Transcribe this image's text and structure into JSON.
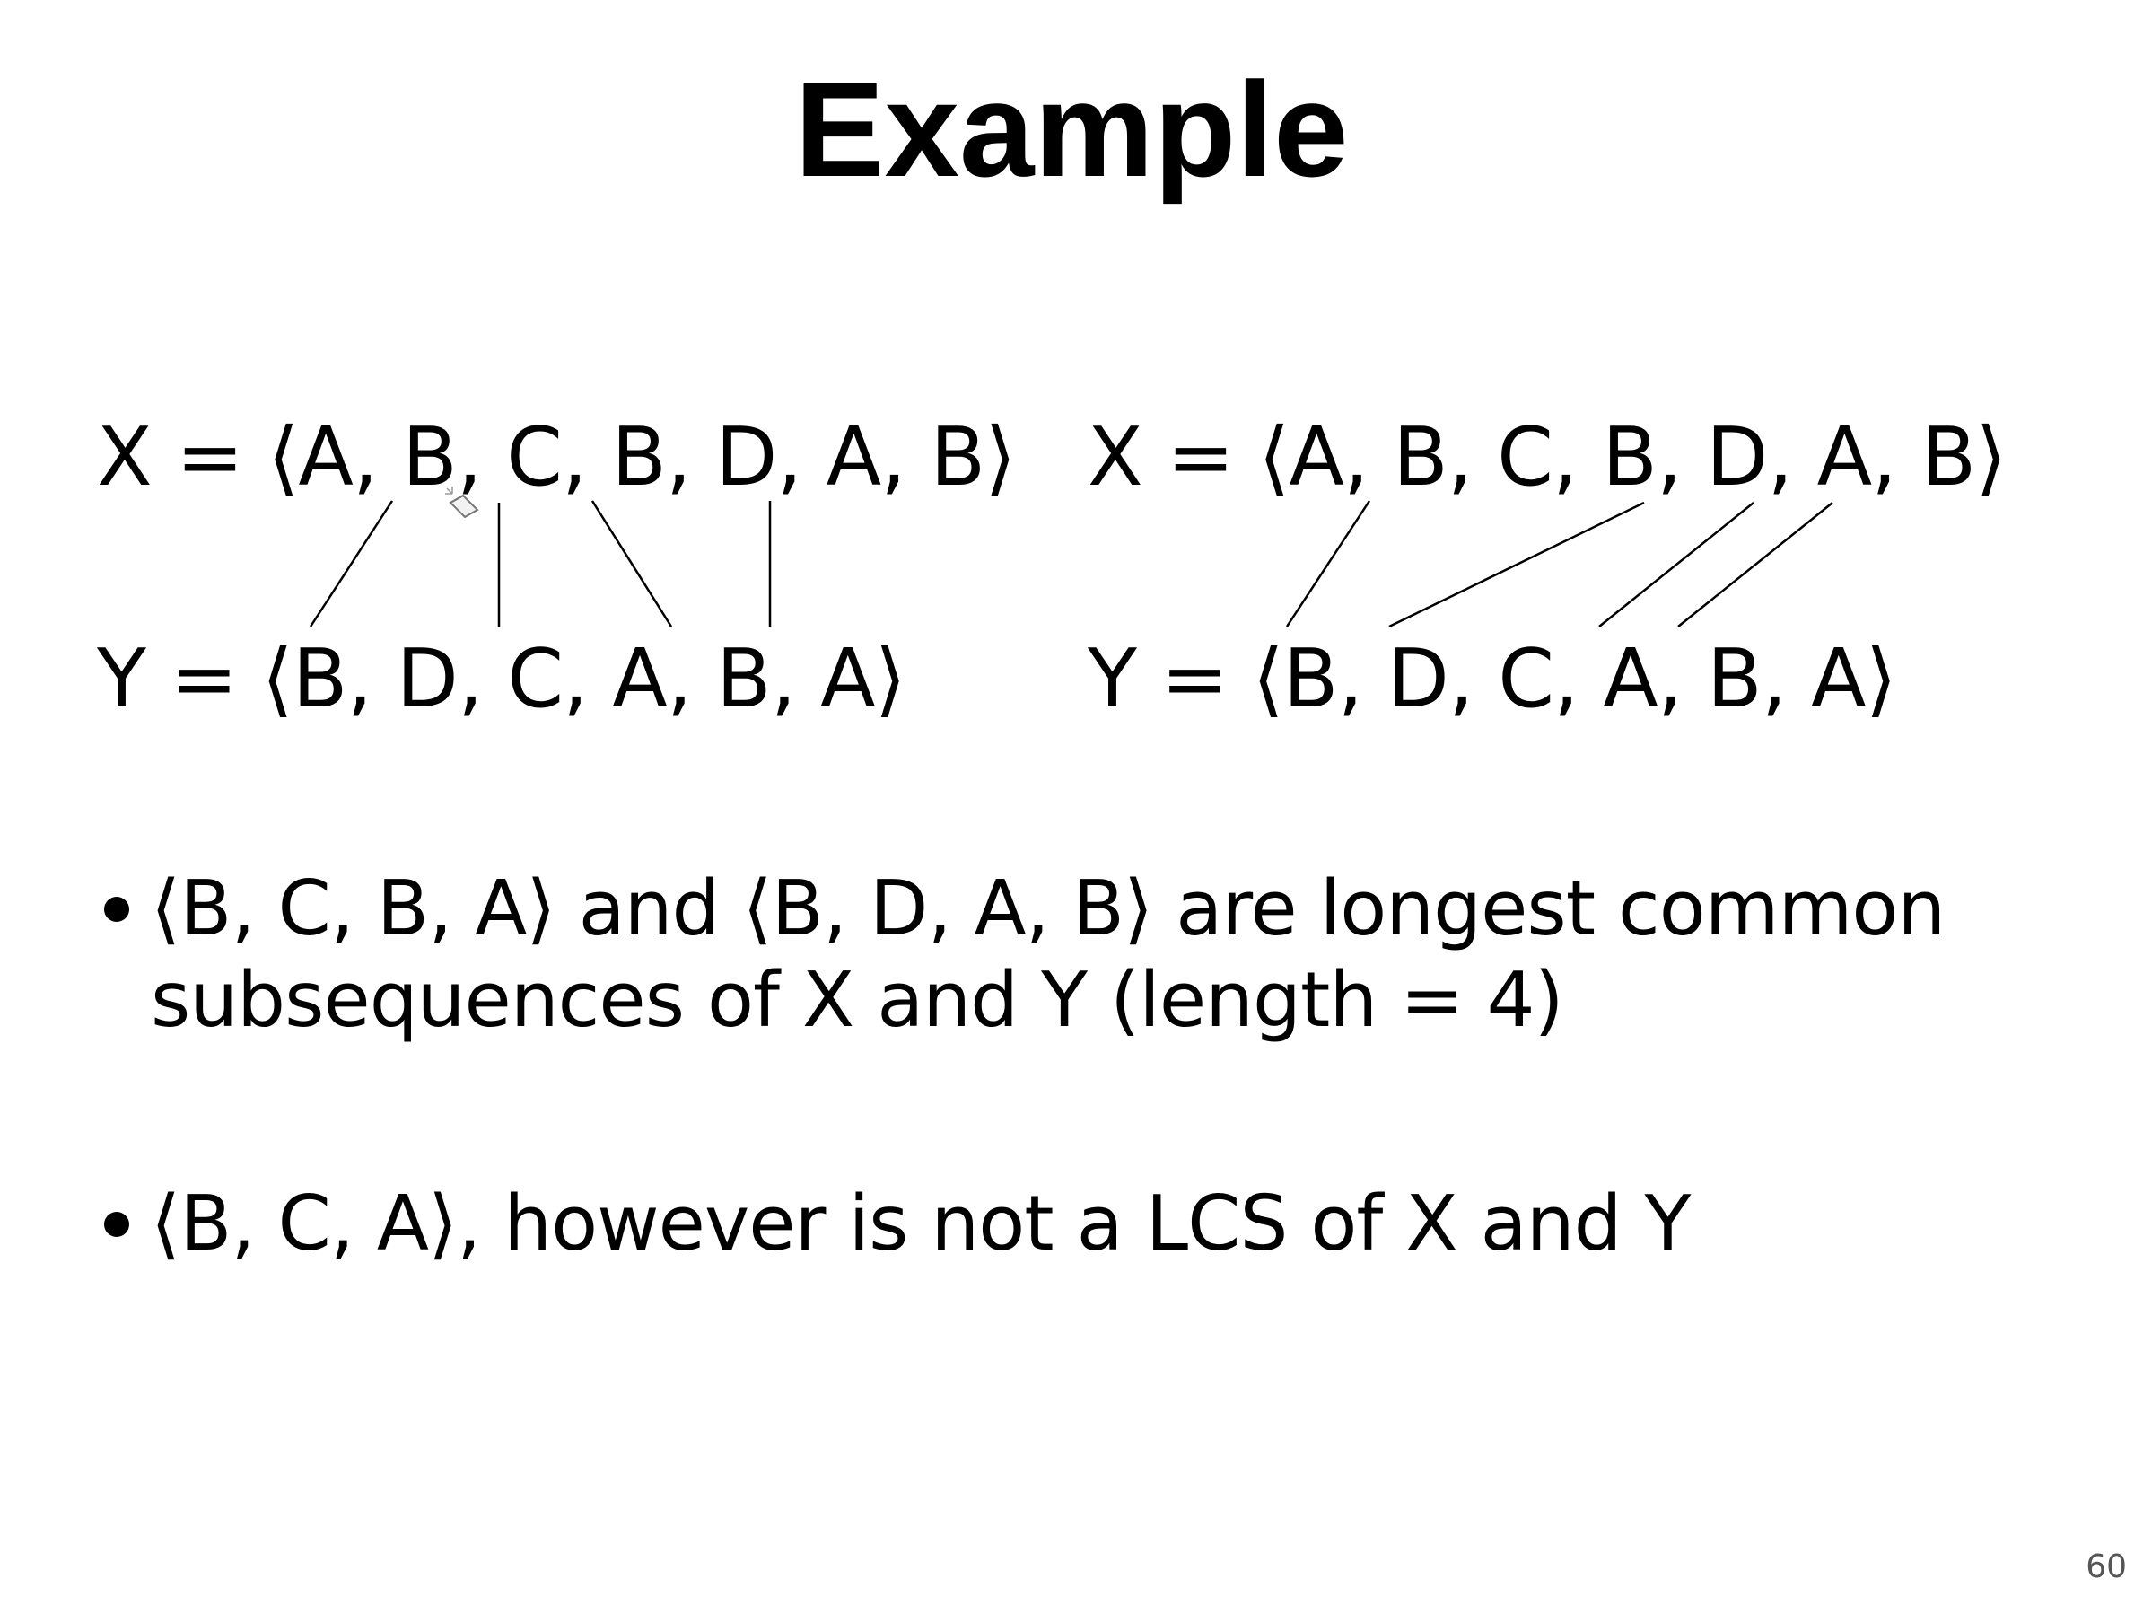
{
  "slide": {
    "title": "Example",
    "left_diagram": {
      "x_sequence": "X = ⟨A, B, C, B, D, A, B⟩",
      "y_sequence": "Y = ⟨B, D, C, A, B, A⟩"
    },
    "right_diagram": {
      "x_sequence": "X = ⟨A, B, C, B, D, A, B⟩",
      "y_sequence": "Y = ⟨B, D, C, A, B, A⟩"
    },
    "bullets": [
      {
        "line1": "⟨B, C, B, A⟩ and ⟨B, D, A, B⟩ are longest common",
        "line2": "subsequences of X and Y (length = 4)"
      },
      {
        "line1": "⟨B, C, A⟩, however is not a LCS of X and Y"
      }
    ],
    "page_number": "60"
  },
  "icons": {
    "cursor": "pencil-cursor-icon"
  }
}
